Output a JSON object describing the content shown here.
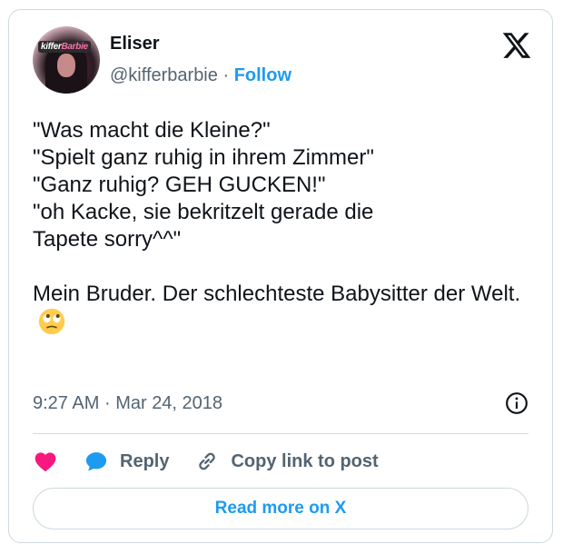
{
  "author": {
    "name": "Eliser",
    "handle": "@kifferbarbie",
    "separator": "·",
    "follow_label": "Follow",
    "avatar_logo_text": "kifferBarbie"
  },
  "tweet": {
    "lines": [
      "\"Was macht die Kleine?\"",
      "\"Spielt ganz ruhig in ihrem Zimmer\"",
      "\"Ganz ruhig? GEH GUCKEN!\"",
      "\"oh Kacke, sie bekritzelt gerade die",
      "Tapete sorry^^\""
    ],
    "second_paragraph": "Mein Bruder. Der schlechteste Babysitter der Welt.",
    "emoji": "face-with-rolling-eyes"
  },
  "meta": {
    "time": "9:27 AM",
    "separator": "·",
    "date": "Mar 24, 2018"
  },
  "actions": {
    "reply_label": "Reply",
    "copy_label": "Copy link to post"
  },
  "read_more_label": "Read more on X",
  "colors": {
    "accent": "#1d9bf0",
    "like": "#f91880",
    "muted": "#536471",
    "border": "#cfd9de"
  }
}
